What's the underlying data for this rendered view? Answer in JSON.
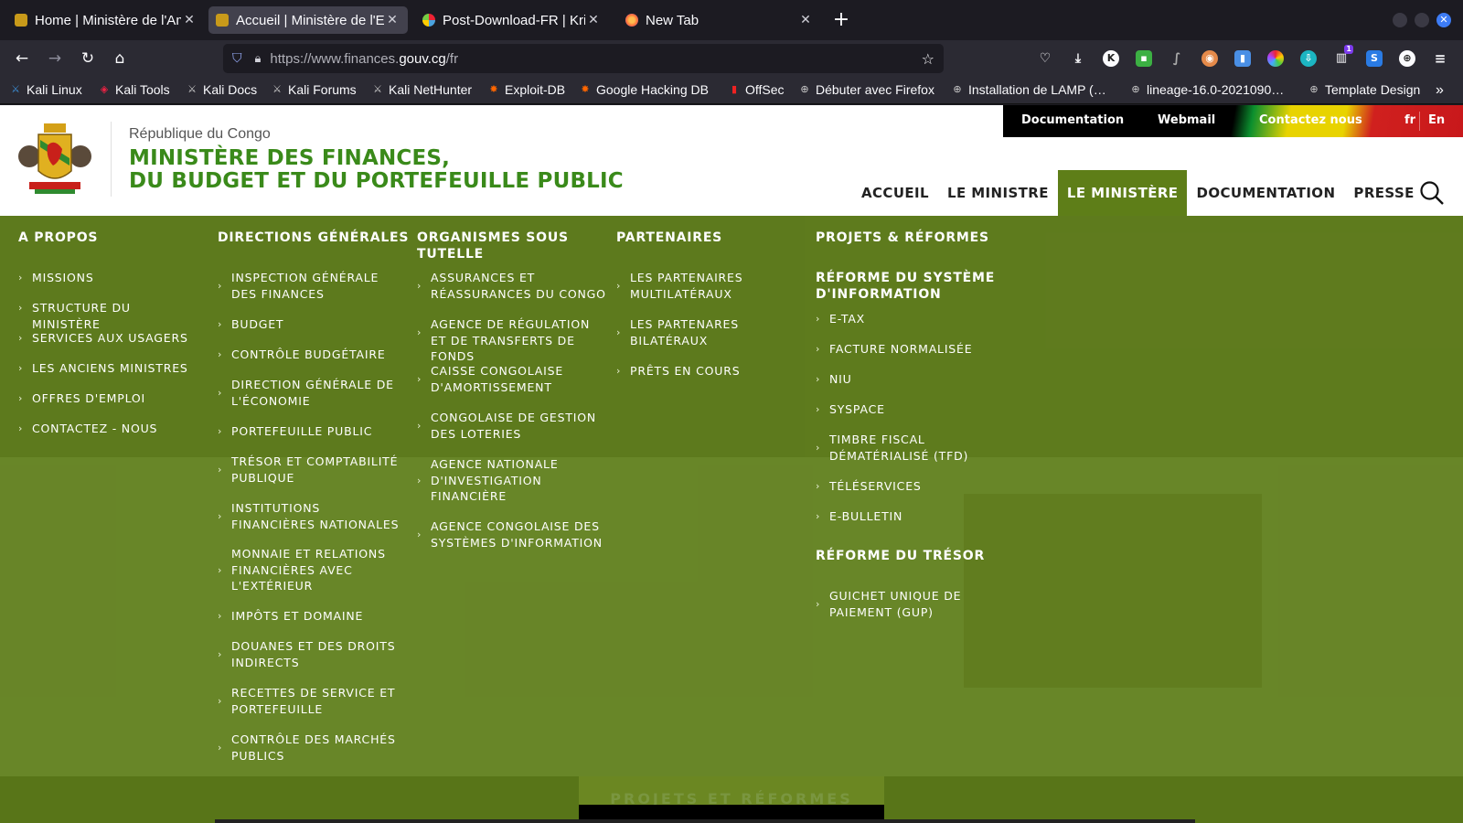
{
  "browser": {
    "tabs": [
      {
        "title": "Home | Ministère de l'Am",
        "active": false,
        "favicon_color": "#c89a1a"
      },
      {
        "title": "Accueil | Ministère de l'Ec",
        "active": true,
        "favicon_color": "#c89a1a"
      },
      {
        "title": "Post-Download-FR | Krita",
        "active": false,
        "favicon_color": "#4aa3df"
      },
      {
        "title": "New Tab",
        "active": false,
        "favicon_color": "#ff7139"
      }
    ],
    "url_prefix": "https://www.finances.",
    "url_domain": "gouv.cg",
    "url_path": "/fr",
    "bookmarks": [
      "Kali Linux",
      "Kali Tools",
      "Kali Docs",
      "Kali Forums",
      "Kali NetHunter",
      "Exploit-DB",
      "Google Hacking DB",
      "OffSec",
      "Débuter avec Firefox",
      "Installation de LAMP (…",
      "lineage-16.0-2021090…",
      "Template Design"
    ],
    "extension_badge": "1"
  },
  "site": {
    "republic": "République du Congo",
    "ministry_line1": "MINISTÈRE DES FINANCES,",
    "ministry_line2": "DU BUDGET ET DU PORTEFEUILLE PUBLIC",
    "topbar": {
      "documentation": "Documentation",
      "webmail": "Webmail",
      "contact": "Contactez nous",
      "lang_fr": "fr",
      "lang_en": "En"
    },
    "nav": [
      "ACCUEIL",
      "LE MINISTRE",
      "LE MINISTÈRE",
      "DOCUMENTATION",
      "PRESSE"
    ],
    "nav_active": "LE MINISTÈRE",
    "bottom_button": "PROJETS ET RÉFORMES"
  },
  "menu": {
    "apropos": {
      "title": "A PROPOS",
      "items": [
        "MISSIONS",
        "STRUCTURE DU MINISTÈRE",
        "SERVICES AUX USAGERS",
        "LES ANCIENS MINISTRES",
        "OFFRES D'EMPLOI",
        "CONTACTEZ - NOUS"
      ]
    },
    "directions": {
      "title": "DIRECTIONS GÉNÉRALES",
      "items": [
        "INSPECTION GÉNÉRALE DES FINANCES",
        "BUDGET",
        "CONTRÔLE BUDGÉTAIRE",
        "DIRECTION GÉNÉRALE DE L'ÉCONOMIE",
        "PORTEFEUILLE PUBLIC",
        "TRÉSOR ET COMPTABILITÉ PUBLIQUE",
        "INSTITUTIONS FINANCIÈRES NATIONALES",
        "MONNAIE ET RELATIONS FINANCIÈRES AVEC L'EXTÉRIEUR",
        "IMPÔTS ET DOMAINE",
        "DOUANES ET DES DROITS INDIRECTS",
        "RECETTES DE SERVICE ET PORTEFEUILLE",
        "CONTRÔLE DES MARCHÉS PUBLICS"
      ]
    },
    "organismes": {
      "title": "ORGANISMES SOUS TUTELLE",
      "items": [
        "ASSURANCES ET RÉASSURANCES DU CONGO",
        "AGENCE DE RÉGULATION ET DE TRANSFERTS DE FONDS",
        "CAISSE CONGOLAISE D'AMORTISSEMENT",
        "CONGOLAISE DE GESTION DES LOTERIES",
        "AGENCE NATIONALE D'INVESTIGATION FINANCIÈRE",
        "AGENCE CONGOLAISE DES SYSTÈMES D'INFORMATION"
      ]
    },
    "partenaires": {
      "title": "PARTENAIRES",
      "items": [
        "LES PARTENAIRES MULTILATÉRAUX",
        "LES PARTENARES BILATÉRAUX",
        "PRÊTS EN COURS"
      ]
    },
    "projets": {
      "title": "PROJETS & RÉFORMES",
      "sub1": "RÉFORME DU SYSTÈME D'INFORMATION",
      "sub1_items": [
        "E-TAX",
        "FACTURE NORMALISÉE",
        "NIU",
        "SYSPACE",
        "TIMBRE FISCAL DÉMATÉRIALISÉ (TFD)",
        "TÉLÉSERVICES",
        "E-BULLETIN"
      ],
      "sub2": "RÉFORME DU TRÉSOR",
      "sub2_items": [
        "GUICHET UNIQUE DE PAIEMENT (GUP)"
      ]
    }
  }
}
